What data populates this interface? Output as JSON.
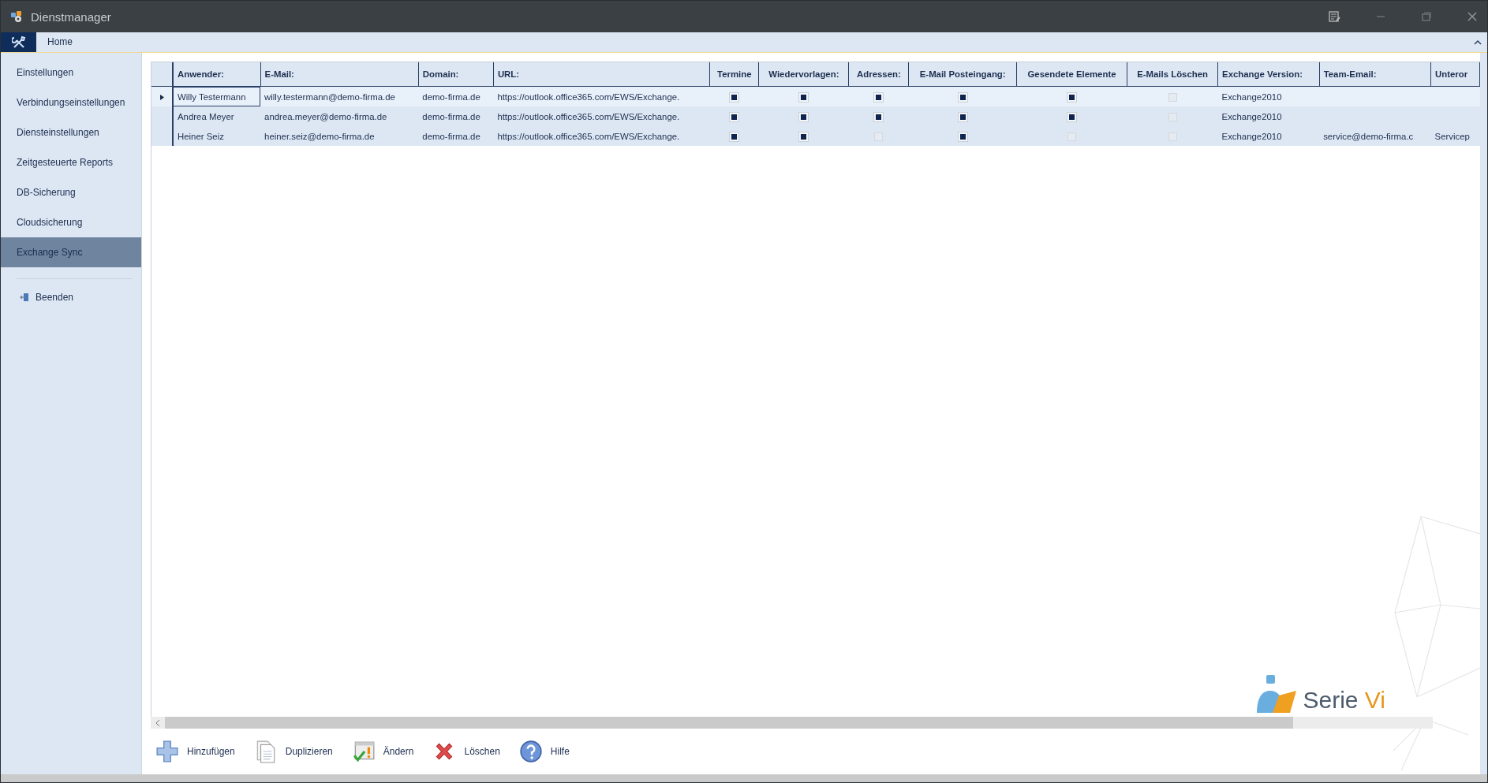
{
  "window": {
    "title": "Dienstmanager"
  },
  "ribbon": {
    "tabs": [
      {
        "label": "Home",
        "selected": true
      }
    ]
  },
  "sidebar": {
    "items": [
      {
        "label": "Einstellungen",
        "selected": false
      },
      {
        "label": "Verbindungseinstellungen",
        "selected": false
      },
      {
        "label": "Diensteinstellungen",
        "selected": false
      },
      {
        "label": "Zeitgesteuerte Reports",
        "selected": false
      },
      {
        "label": "DB-Sicherung",
        "selected": false
      },
      {
        "label": "Cloudsicherung",
        "selected": false
      },
      {
        "label": "Exchange Sync",
        "selected": true
      }
    ],
    "exit": {
      "label": "Beenden"
    }
  },
  "table": {
    "columns": [
      {
        "label": "Anwender:",
        "kind": "text"
      },
      {
        "label": "E-Mail:",
        "kind": "text"
      },
      {
        "label": "Domain:",
        "kind": "text"
      },
      {
        "label": "URL:",
        "kind": "text"
      },
      {
        "label": "Termine",
        "kind": "check"
      },
      {
        "label": "Wiedervorlagen:",
        "kind": "check"
      },
      {
        "label": "Adressen:",
        "kind": "check"
      },
      {
        "label": "E-Mail Posteingang:",
        "kind": "check"
      },
      {
        "label": "Gesendete Elemente",
        "kind": "check"
      },
      {
        "label": "E-Mails Löschen",
        "kind": "check"
      },
      {
        "label": "Exchange Version:",
        "kind": "text"
      },
      {
        "label": "Team-Email:",
        "kind": "text"
      },
      {
        "label": "Unteror",
        "kind": "text"
      }
    ],
    "rows": [
      {
        "selected": true,
        "cells": [
          {
            "text": "Willy Testermann"
          },
          {
            "text": "willy.testermann@demo-firma.de"
          },
          {
            "text": "demo-firma.de"
          },
          {
            "text": "https://outlook.office365.com/EWS/Exchange."
          },
          {
            "checked": true
          },
          {
            "checked": true
          },
          {
            "checked": true
          },
          {
            "checked": true
          },
          {
            "checked": true
          },
          {
            "checked": false
          },
          {
            "text": "Exchange2010"
          },
          {},
          {}
        ]
      },
      {
        "selected": false,
        "cells": [
          {
            "text": "Andrea Meyer"
          },
          {
            "text": "andrea.meyer@demo-firma.de"
          },
          {
            "text": "demo-firma.de"
          },
          {
            "text": "https://outlook.office365.com/EWS/Exchange."
          },
          {
            "checked": true
          },
          {
            "checked": true
          },
          {
            "checked": true
          },
          {
            "checked": true
          },
          {
            "checked": true
          },
          {
            "checked": false
          },
          {
            "text": "Exchange2010"
          },
          {},
          {}
        ]
      },
      {
        "selected": false,
        "cells": [
          {
            "text": "Heiner Seiz"
          },
          {
            "text": "heiner.seiz@demo-firma.de"
          },
          {
            "text": "demo-firma.de"
          },
          {
            "text": "https://outlook.office365.com/EWS/Exchange."
          },
          {
            "checked": true
          },
          {
            "checked": true
          },
          {
            "checked": false
          },
          {
            "checked": true
          },
          {
            "checked": false
          },
          {
            "checked": false
          },
          {
            "text": "Exchange2010"
          },
          {
            "text": "service@demo-firma.c"
          },
          {
            "text": "Servicep"
          }
        ]
      }
    ]
  },
  "logo": {
    "name": "Serie",
    "accent": "Vi"
  },
  "toolbar": [
    {
      "kind": "add",
      "label": "Hinzufügen"
    },
    {
      "kind": "duplicate",
      "label": "Duplizieren"
    },
    {
      "kind": "edit",
      "label": "Ändern"
    },
    {
      "kind": "delete",
      "label": "Löschen"
    },
    {
      "kind": "help",
      "label": "Hilfe"
    }
  ]
}
